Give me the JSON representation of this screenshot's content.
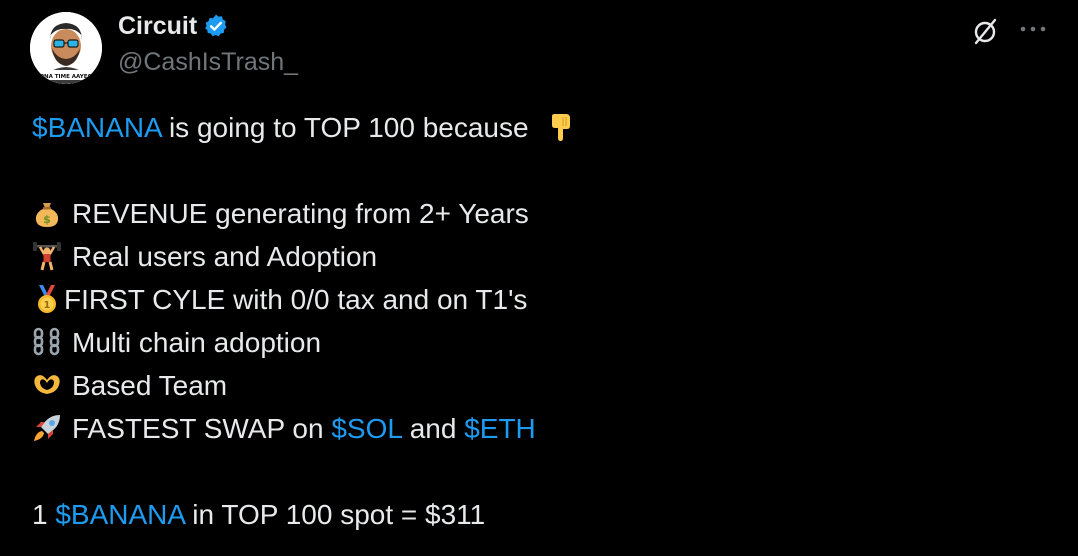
{
  "author": {
    "display_name": "Circuit",
    "handle": "@CashIsTrash_",
    "avatar_caption": "APNA TIME AAYEGA"
  },
  "header_icons": {
    "verified": "verified-badge-icon",
    "grok": "grok-icon",
    "more": "more-options-icon"
  },
  "tweet": {
    "line1": {
      "cashtag": "$BANANA",
      "text": " is going to TOP 100 because ",
      "emoji": "backhand-index-pointing-down"
    },
    "items": [
      {
        "emoji": "money-bag",
        "text": "REVENUE generating from 2+ Years"
      },
      {
        "emoji": "weight-lifter",
        "text": "Real users and Adoption"
      },
      {
        "emoji": "first-place-medal",
        "text": "FIRST CYLE with 0/0 tax and on T1's"
      },
      {
        "emoji": "chains",
        "text": "Multi chain adoption"
      },
      {
        "emoji": "heart-hands",
        "text": "Based Team"
      }
    ],
    "rocket_line": {
      "emoji": "rocket",
      "text_before": "FASTEST SWAP on ",
      "cashtag1": "$SOL",
      "text_middle": " and ",
      "cashtag2": "$ETH"
    },
    "last_line": {
      "prefix": "1 ",
      "cashtag": "$BANANA",
      "suffix": " in TOP 100 spot = $311"
    }
  },
  "colors": {
    "background": "#000000",
    "text": "#e7e9ea",
    "secondary": "#71767b",
    "link": "#1d9bf0"
  }
}
